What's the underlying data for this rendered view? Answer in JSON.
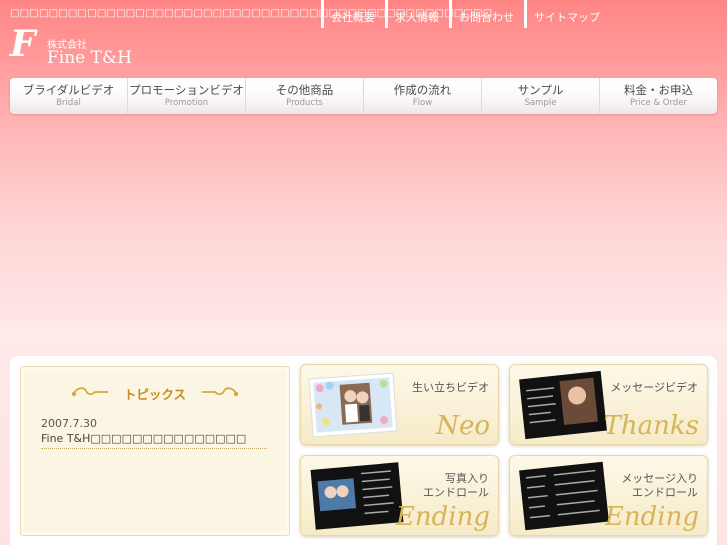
{
  "header": {
    "tagline": "□□□□□□□□□□□□□□□□□□□□□□□□□□□□□□□□□□□□□□□□□□□□□□□□□□",
    "logo_mark": "F",
    "logo_company": "株式会社",
    "logo_name": "Fine T&H"
  },
  "top_links": [
    "会社概要",
    "求人情報",
    "お問合わせ",
    "サイトマップ"
  ],
  "nav": [
    {
      "jp": "ブライダルビデオ",
      "en": "Bridal"
    },
    {
      "jp": "プロモーションビデオ",
      "en": "Promotion"
    },
    {
      "jp": "その他商品",
      "en": "Products"
    },
    {
      "jp": "作成の流れ",
      "en": "Flow"
    },
    {
      "jp": "サンプル",
      "en": "Sample"
    },
    {
      "jp": "料金・お申込",
      "en": "Price & Order"
    }
  ],
  "topics": {
    "title": "トピックス",
    "items": [
      {
        "date": "2007.7.30",
        "text": "Fine T&H□□□□□□□□□□□□□□□"
      }
    ]
  },
  "cards": [
    {
      "label": "生い立ちビデオ",
      "script": "Neo"
    },
    {
      "label": "メッセージビデオ",
      "script": "Thanks"
    },
    {
      "label": "写真入り\nエンドロール",
      "script": "Ending"
    },
    {
      "label": "メッセージ入り\nエンドロール",
      "script": "Ending"
    }
  ],
  "colors": {
    "header_pink": "#ff8585",
    "accent_gold": "#c88a1e",
    "script_gold": "#d7b45a"
  }
}
